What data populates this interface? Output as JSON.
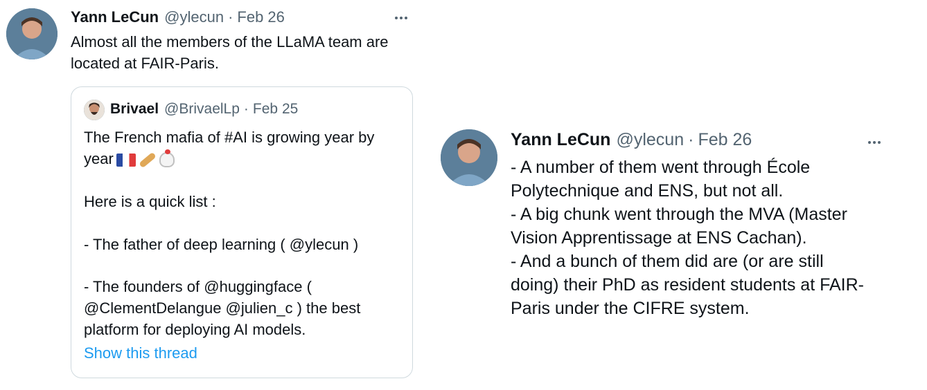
{
  "tweet_left": {
    "author_name": "Yann LeCun",
    "handle": "@ylecun",
    "separator": "·",
    "date": "Feb 26",
    "text_lines": [
      "Almost all the members of the LLaMA team are",
      "located at FAIR-Paris."
    ],
    "quote": {
      "author_name": "Brivael",
      "handle": "@BrivaelLp",
      "separator": "·",
      "date": "Feb 25",
      "lines": [
        "The French mafia of #AI is growing year by",
        "year",
        "",
        "Here is a quick list :",
        "",
        "- The father of deep learning ( @ylecun )",
        "",
        "- The founders of @huggingface (",
        "@ClementDelangue @julien_c  ) the best",
        "platform for deploying AI models."
      ],
      "emoji_names": [
        "france-flag-icon",
        "baguette-icon",
        "rooster-icon"
      ],
      "show_thread": "Show this thread"
    }
  },
  "tweet_right": {
    "author_name": "Yann LeCun",
    "handle": "@ylecun",
    "separator": "·",
    "date": "Feb 26",
    "text_lines": [
      "- A number of them went through École",
      "Polytechnique and ENS, but not all.",
      "- A big chunk went through the MVA (Master",
      "Vision Apprentissage at ENS Cachan).",
      "- And a bunch of them did are (or are still",
      "doing) their PhD as resident students at FAIR-",
      "Paris under the CIFRE system."
    ]
  },
  "colors": {
    "text": "#0f1419",
    "secondary": "#536471",
    "link": "#1d9bf0",
    "border": "#cfd9de"
  }
}
